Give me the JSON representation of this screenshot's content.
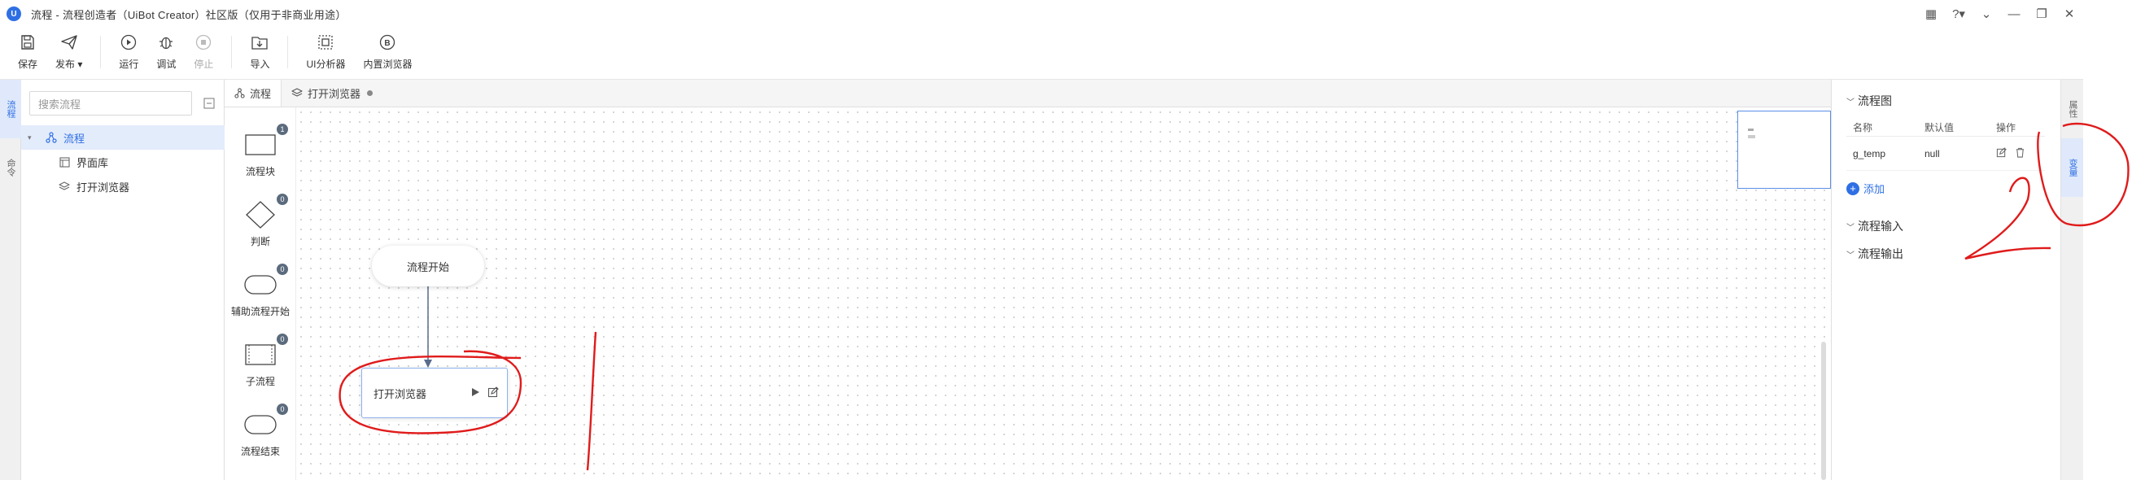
{
  "window": {
    "title": "流程 - 流程创造者（UiBot Creator）社区版（仅用于非商业用途）",
    "logo_text": "U"
  },
  "toolbar": {
    "save": "保存",
    "publish": "发布",
    "run": "运行",
    "debug": "调试",
    "stop": "停止",
    "import": "导入",
    "ui_analyzer": "UI分析器",
    "builtin_browser": "内置浏览器"
  },
  "left_tabs": [
    "流程",
    "命令"
  ],
  "search": {
    "placeholder": "搜索流程"
  },
  "tree": {
    "root": "流程",
    "items": [
      "界面库",
      "打开浏览器"
    ]
  },
  "editor_tabs": [
    "流程",
    "打开浏览器"
  ],
  "palette": [
    {
      "label": "流程块",
      "count": "1"
    },
    {
      "label": "判断",
      "count": "0"
    },
    {
      "label": "辅助流程开始",
      "count": "0"
    },
    {
      "label": "子流程",
      "count": "0"
    },
    {
      "label": "流程结束",
      "count": "0"
    }
  ],
  "canvas": {
    "start_node": "流程开始",
    "block_node": "打开浏览器"
  },
  "right_panel": {
    "section_title": "流程图",
    "columns": [
      "名称",
      "默认值",
      "操作"
    ],
    "variables": [
      {
        "name": "g_temp",
        "default": "null"
      }
    ],
    "add_label": "添加",
    "inputs_title": "流程输入",
    "outputs_title": "流程输出"
  },
  "right_tabs": [
    "属性",
    "变量"
  ],
  "colors": {
    "accent": "#2f6fe4",
    "annotation": "#e01b1b"
  }
}
